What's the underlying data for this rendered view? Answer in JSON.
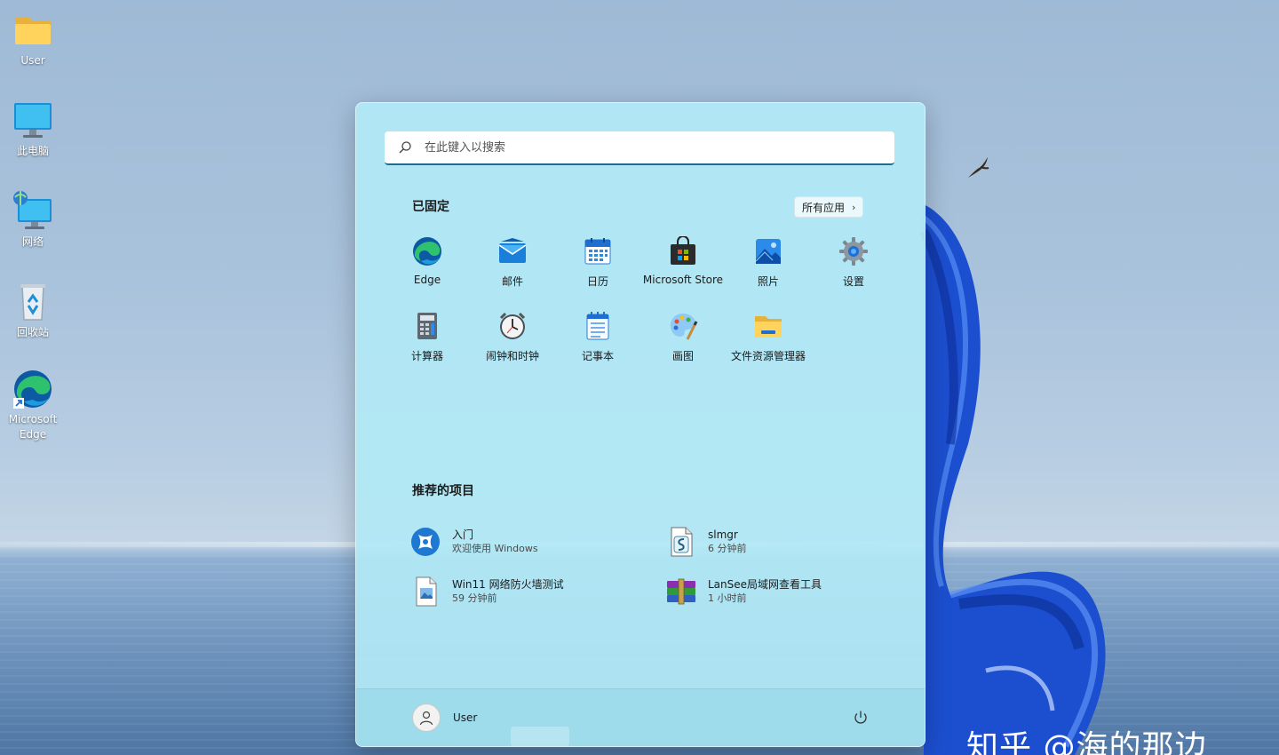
{
  "desktop": {
    "icons": [
      {
        "label": "User",
        "icon": "folder-icon"
      },
      {
        "label": "此电脑",
        "icon": "monitor-icon"
      },
      {
        "label": "网络",
        "icon": "network-icon"
      },
      {
        "label": "回收站",
        "icon": "recycle-bin-icon"
      },
      {
        "label": "Microsoft Edge",
        "icon": "edge-icon"
      }
    ],
    "watermark": "知乎 @海的那边"
  },
  "start_menu": {
    "search": {
      "placeholder": "在此键入以搜索"
    },
    "pinned": {
      "title": "已固定",
      "all_apps_label": "所有应用",
      "apps": [
        {
          "label": "Edge",
          "icon": "edge-icon"
        },
        {
          "label": "邮件",
          "icon": "mail-icon"
        },
        {
          "label": "日历",
          "icon": "calendar-icon"
        },
        {
          "label": "Microsoft Store",
          "icon": "store-icon"
        },
        {
          "label": "照片",
          "icon": "photos-icon"
        },
        {
          "label": "设置",
          "icon": "gear-icon"
        },
        {
          "label": "计算器",
          "icon": "calculator-icon"
        },
        {
          "label": "闹钟和时钟",
          "icon": "clock-icon"
        },
        {
          "label": "记事本",
          "icon": "notepad-icon"
        },
        {
          "label": "画图",
          "icon": "paint-icon"
        },
        {
          "label": "文件资源管理器",
          "icon": "file-explorer-icon"
        }
      ]
    },
    "recommended": {
      "title": "推荐的项目",
      "items": [
        {
          "title": "入门",
          "subtitle": "欢迎使用 Windows",
          "icon": "get-started-icon"
        },
        {
          "title": "slmgr",
          "subtitle": "6 分钟前",
          "icon": "script-file-icon"
        },
        {
          "title": "Win11 网络防火墙测试",
          "subtitle": "59 分钟前",
          "icon": "image-file-icon"
        },
        {
          "title": "LanSee局域网查看工具",
          "subtitle": "1 小时前",
          "icon": "archive-icon"
        }
      ]
    },
    "footer": {
      "user_name": "User"
    }
  },
  "colors": {
    "accent": "#1f6e8c",
    "menu_background": "#b2e8f5",
    "edge_blue": "#0c59a4",
    "edge_green": "#2fc26e"
  }
}
